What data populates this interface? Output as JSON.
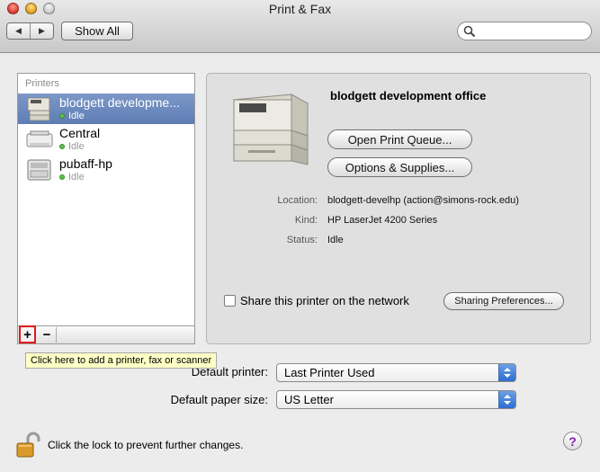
{
  "window": {
    "title": "Print & Fax"
  },
  "toolbar": {
    "back_icon": "back-arrow-icon",
    "forward_icon": "forward-arrow-icon",
    "show_all_label": "Show All",
    "search_placeholder": ""
  },
  "printers": {
    "header": "Printers",
    "items": [
      {
        "name": "blodgett developme...",
        "status": "Idle",
        "selected": true
      },
      {
        "name": "Central",
        "status": "Idle",
        "selected": false
      },
      {
        "name": "pubaff-hp",
        "status": "Idle",
        "selected": false
      }
    ],
    "add_label": "+",
    "remove_label": "−",
    "add_tooltip": "Click here to add a printer, fax or scanner"
  },
  "detail": {
    "printer_name": "blodgett development office",
    "open_queue_label": "Open Print Queue...",
    "options_label": "Options & Supplies...",
    "location_label": "Location:",
    "location_value": "blodgett-develhp (action@simons-rock.edu)",
    "kind_label": "Kind:",
    "kind_value": "HP LaserJet 4200 Series",
    "status_label": "Status:",
    "status_value": "Idle",
    "share_label": "Share this printer on the network",
    "share_checked": false,
    "sharing_prefs_label": "Sharing Preferences..."
  },
  "defaults": {
    "printer_label": "Default printer:",
    "printer_value": "Last Printer Used",
    "paper_label": "Default paper size:",
    "paper_value": "US Letter"
  },
  "footer": {
    "lock_text": "Click the lock to prevent further changes.",
    "help_label": "?"
  },
  "colors": {
    "selection": "#6b89bd",
    "highlight": "#e21a1a",
    "tooltip": "#ffffc6"
  }
}
